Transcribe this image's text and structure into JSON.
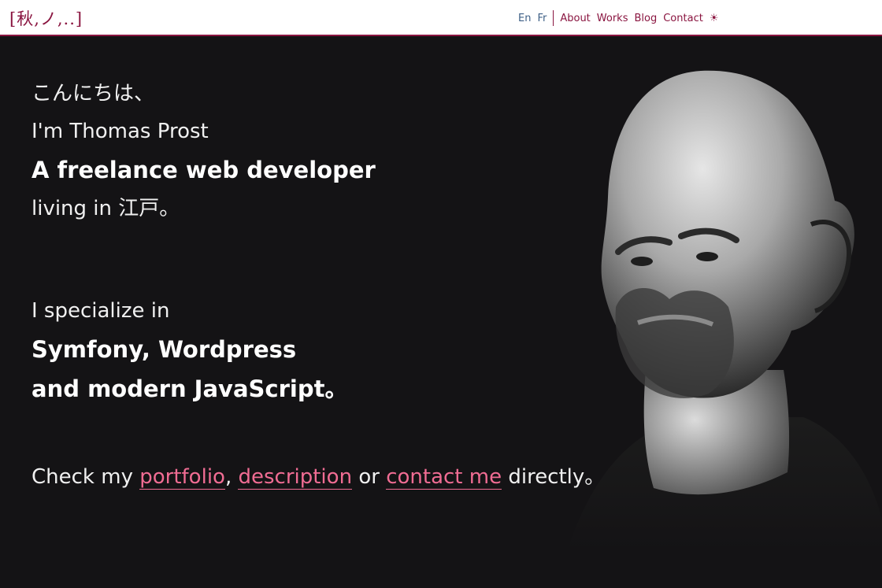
{
  "header": {
    "logo_text": "[秋,ノ,..]",
    "lang_en": "En",
    "lang_fr": "Fr",
    "nav": [
      "About",
      "Works",
      "Blog",
      "Contact"
    ],
    "theme_toggle": "☀"
  },
  "hero": {
    "greeting": "こんにちは、",
    "intro": "I'm Thomas Prost",
    "role": "A freelance web developer",
    "location": "living in 江戸。",
    "specialize_intro": "I specialize in",
    "skills_line1": "Symfony, Wordpress",
    "skills_line2": "and modern JavaScript。",
    "cta_prefix": "Check my",
    "cta_portfolio": "portfolio",
    "cta_comma": ",",
    "cta_description": "description",
    "cta_or": "or",
    "cta_contact": "contact me",
    "cta_suffix": "directly。"
  },
  "colors": {
    "brand": "#8a1540",
    "link": "#f06c93",
    "lang_active": "#3d5f86",
    "background": "#141315"
  }
}
